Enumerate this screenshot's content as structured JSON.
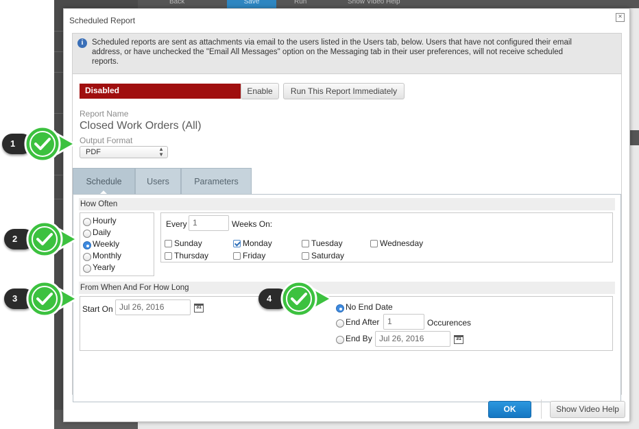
{
  "background": {
    "toolbar": [
      "Back",
      "Save",
      "Run",
      "Show Video Help"
    ]
  },
  "dialog": {
    "title": "Scheduled Report",
    "close_glyph": "×",
    "info_text": "Scheduled reports are sent as attachments via email to the users listed in the Users tab, below. Users that have not configured their email address, or have unchecked the \"Email All Messages\" option on the Messaging tab in their user preferences, will not receive scheduled reports.",
    "status_label": "Disabled",
    "enable_label": "Enable",
    "run_now_label": "Run This Report Immediately",
    "report_name_label": "Report Name",
    "report_name": "Closed Work Orders (All)",
    "output_format_label": "Output Format",
    "output_format": "PDF",
    "tabs": [
      "Schedule",
      "Users",
      "Parameters"
    ],
    "active_tab": "Schedule",
    "how_often": {
      "header": "How Often",
      "options": [
        "Hourly",
        "Daily",
        "Weekly",
        "Monthly",
        "Yearly"
      ],
      "selected": "Weekly",
      "every_label": "Every",
      "every_value": "1",
      "weeks_on_label": "Weeks On:",
      "days": [
        {
          "label": "Sunday",
          "checked": false
        },
        {
          "label": "Monday",
          "checked": true
        },
        {
          "label": "Tuesday",
          "checked": false
        },
        {
          "label": "Wednesday",
          "checked": false
        },
        {
          "label": "Thursday",
          "checked": false
        },
        {
          "label": "Friday",
          "checked": false
        },
        {
          "label": "Saturday",
          "checked": false
        }
      ]
    },
    "from_when": {
      "header": "From When And For How Long",
      "start_on_label": "Start On",
      "start_on_value": "Jul 26, 2016",
      "no_end_label": "No End Date",
      "end_after_label": "End After",
      "end_after_value": "1",
      "occurrences_label": "Occurences",
      "end_by_label": "End By",
      "end_by_value": "Jul 26, 2016",
      "selected": "No End Date"
    },
    "ok_label": "OK",
    "help_label": "Show Video Help"
  },
  "callouts": [
    "1",
    "2",
    "3",
    "4"
  ],
  "colors": {
    "status_red": "#a00f0f",
    "ok_blue": "#1e88d2",
    "callout_green": "#3cc13f",
    "callout_dark": "#2b2b2b"
  }
}
